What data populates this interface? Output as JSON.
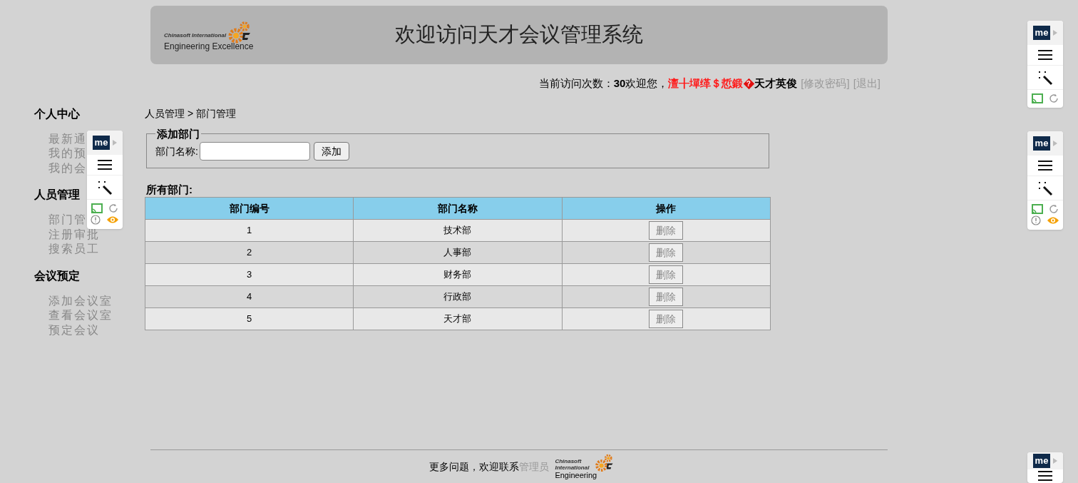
{
  "header": {
    "logo": {
      "line_1": "Chinasoft International",
      "line_2": "Engineering Excellence"
    },
    "title": "欢迎访问天才会议管理系统"
  },
  "user_bar": {
    "visit_label": "当前访问次数：",
    "visit_count": "30",
    "welcome": "欢迎您，",
    "garbled_name": "澶╂墠缂＄悊鍛",
    "invalid_char_mark": "?",
    "name": "天才英俊",
    "links": [
      "[修改密码]",
      "[退出]"
    ]
  },
  "sidebar": [
    {
      "heading": "个人中心",
      "items": [
        "最新通",
        "我的预",
        "我的会"
      ]
    },
    {
      "heading": "人员管理",
      "items": [
        "部门管",
        "注册审批",
        "搜索员工"
      ]
    },
    {
      "heading": "会议预定",
      "items": [
        "添加会议室",
        "查看会议室",
        "预定会议"
      ]
    }
  ],
  "breadcrumb": "人员管理 > 部门管理",
  "add_form": {
    "legend": "添加部门",
    "label": "部门名称:",
    "button": "添加"
  },
  "list_title": "所有部门:",
  "table": {
    "columns": [
      "部门编号",
      "部门名称",
      "操作"
    ],
    "rows": [
      {
        "id": "1",
        "name": "技术部",
        "action": "删除"
      },
      {
        "id": "2",
        "name": "人事部",
        "action": "删除"
      },
      {
        "id": "3",
        "name": "财务部",
        "action": "删除"
      },
      {
        "id": "4",
        "name": "行政部",
        "action": "删除"
      },
      {
        "id": "5",
        "name": "天才部",
        "action": "删除"
      }
    ]
  },
  "footer": {
    "text": "更多问题，欢迎联系",
    "link": "管理员",
    "logo": {
      "line_1": "Chinasoft International",
      "line_2": "Engineering"
    }
  },
  "extension_toolbars": [
    {
      "badge": "me",
      "kind": "clipped"
    },
    {
      "badge": "me",
      "kind": "full"
    },
    {
      "badge": "me",
      "kind": "full"
    },
    {
      "badge": "me",
      "kind": "badge-only"
    }
  ]
}
